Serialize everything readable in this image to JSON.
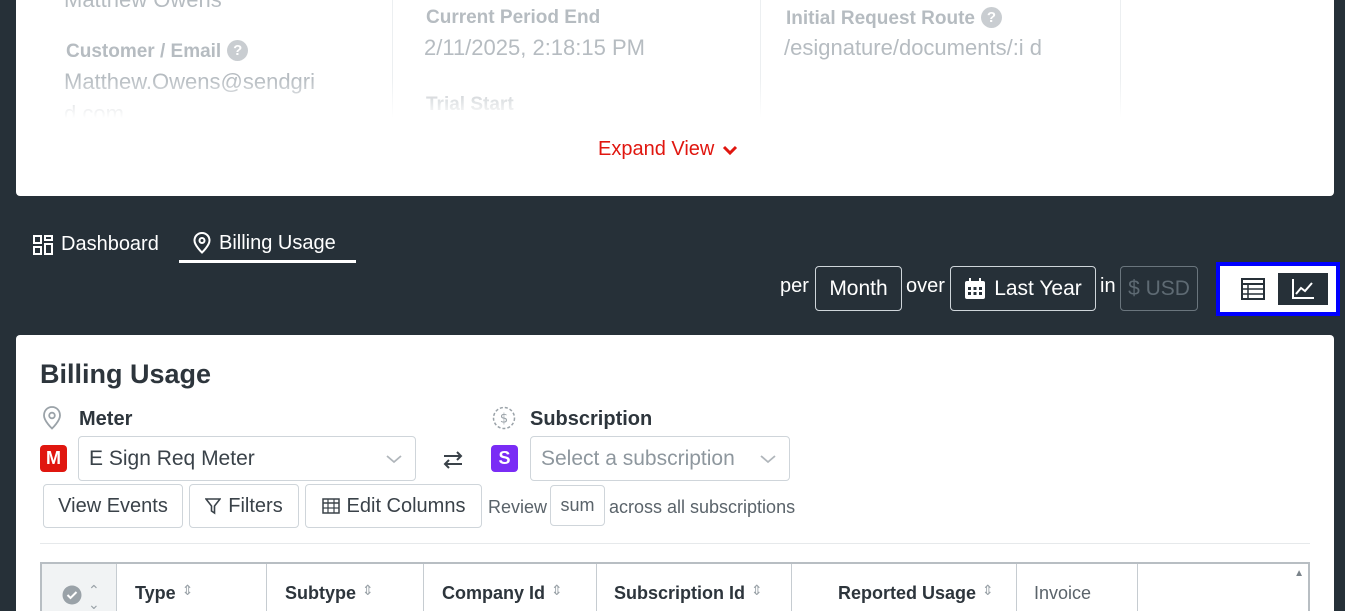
{
  "details": {
    "customer_name": "Matthew Owens",
    "customer_email_label": "Customer / Email",
    "customer_email_value": "Matthew.Owens@sendgri d.com",
    "period_end_label": "Current Period End",
    "period_end_value": "2/11/2025, 2:18:15 PM",
    "trial_start_label": "Trial Start",
    "initial_route_label": "Initial Request Route",
    "initial_route_value": "/esignature/documents/:i d",
    "help_glyph": "?"
  },
  "expand_view_label": "Expand View",
  "tabs": [
    {
      "label": "Dashboard",
      "icon": "dashboard-grid-icon"
    },
    {
      "label": "Billing Usage",
      "icon": "map-pin-icon",
      "active": true
    }
  ],
  "controls": {
    "per_text": "per",
    "period": "Month",
    "over_text": "over",
    "range": "Last Year",
    "in_text": "in",
    "currency": "$ USD"
  },
  "billing": {
    "title": "Billing Usage",
    "meter_label": "Meter",
    "meter_value": "E Sign Req Meter",
    "meter_badge": "M",
    "subscription_label": "Subscription",
    "subscription_placeholder": "Select a subscription",
    "subscription_badge": "S",
    "view_events": "View Events",
    "filters": "Filters",
    "edit_columns": "Edit Columns",
    "review_text": "Review",
    "sum_value": "sum",
    "across_text": "across all subscriptions"
  },
  "table": {
    "columns": [
      "Type",
      "Subtype",
      "Company Id",
      "Subscription Id",
      "Reported Usage",
      "Invoice"
    ]
  },
  "colors": {
    "accent_red": "#e0160f",
    "background_dark": "#263038",
    "highlight_blue": "#0000ff",
    "meter_badge": "#e0160f",
    "subscription_badge": "#7a2cf5"
  }
}
